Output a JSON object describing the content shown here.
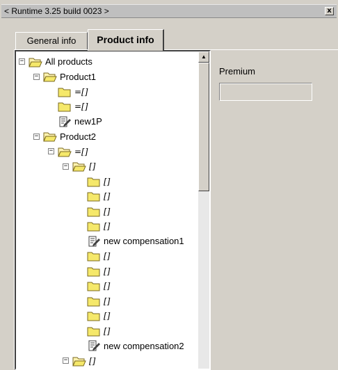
{
  "window": {
    "title": "< Runtime 3.25 build 0023 >",
    "close_label": "x"
  },
  "tabs": [
    {
      "label": "General info",
      "active": false
    },
    {
      "label": "Product info",
      "active": true
    }
  ],
  "tree": {
    "nodes": [
      {
        "level": 0,
        "expander": "−",
        "icon": "folder-open-icon",
        "label": "All products",
        "italic": false
      },
      {
        "level": 1,
        "expander": "−",
        "icon": "folder-open-icon",
        "label": "Product1",
        "italic": false
      },
      {
        "level": 2,
        "expander": "",
        "icon": "folder-icon",
        "label": "=[]",
        "italic": true
      },
      {
        "level": 2,
        "expander": "",
        "icon": "folder-icon",
        "label": "=[]",
        "italic": true
      },
      {
        "level": 2,
        "expander": "",
        "icon": "document-edit-icon",
        "label": "new1P",
        "italic": false
      },
      {
        "level": 1,
        "expander": "−",
        "icon": "folder-open-icon",
        "label": "Product2",
        "italic": false
      },
      {
        "level": 2,
        "expander": "−",
        "icon": "folder-open-icon",
        "label": "=[]",
        "italic": true
      },
      {
        "level": 3,
        "expander": "−",
        "icon": "folder-open-icon",
        "label": "[]",
        "italic": true
      },
      {
        "level": 4,
        "expander": "",
        "icon": "folder-icon",
        "label": "[]",
        "italic": true
      },
      {
        "level": 4,
        "expander": "",
        "icon": "folder-icon",
        "label": "[]",
        "italic": true
      },
      {
        "level": 4,
        "expander": "",
        "icon": "folder-icon",
        "label": "[]",
        "italic": true
      },
      {
        "level": 4,
        "expander": "",
        "icon": "folder-icon",
        "label": "[]",
        "italic": true
      },
      {
        "level": 4,
        "expander": "",
        "icon": "document-edit-icon",
        "label": "new compensation1",
        "italic": false
      },
      {
        "level": 4,
        "expander": "",
        "icon": "folder-icon",
        "label": "[]",
        "italic": true
      },
      {
        "level": 4,
        "expander": "",
        "icon": "folder-icon",
        "label": "[]",
        "italic": true
      },
      {
        "level": 4,
        "expander": "",
        "icon": "folder-icon",
        "label": "[]",
        "italic": true
      },
      {
        "level": 4,
        "expander": "",
        "icon": "folder-icon",
        "label": "[]",
        "italic": true
      },
      {
        "level": 4,
        "expander": "",
        "icon": "folder-icon",
        "label": "[]",
        "italic": true
      },
      {
        "level": 4,
        "expander": "",
        "icon": "folder-icon",
        "label": "[]",
        "italic": true
      },
      {
        "level": 4,
        "expander": "",
        "icon": "document-edit-icon",
        "label": "new compensation2",
        "italic": false
      },
      {
        "level": 3,
        "expander": "−",
        "icon": "folder-open-icon",
        "label": "[]",
        "italic": true
      },
      {
        "level": 4,
        "expander": "",
        "icon": "folder-open-icon",
        "label": "",
        "italic": true
      }
    ]
  },
  "details": {
    "premium_label": "Premium",
    "premium_value": ""
  },
  "colors": {
    "folder": "#f5e86a",
    "folder_edge": "#7a6a20",
    "window_bg": "#d4d0c8"
  }
}
